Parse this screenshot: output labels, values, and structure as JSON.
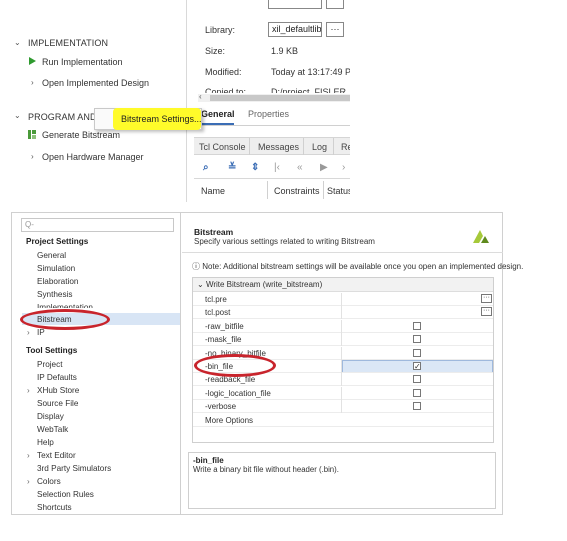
{
  "flow_nav": {
    "implementation_label": "IMPLEMENTATION",
    "run_impl_label": "Run Implementation",
    "open_impl_label": "Open Implemented Design",
    "program_label": "PROGRAM AND D",
    "gen_bitstream_label": "Generate Bitstream",
    "open_hw_label": "Open Hardware Manager"
  },
  "context_menu": {
    "item_label": "Bitstream Settings..."
  },
  "properties": {
    "library_label": "Library:",
    "library_value": "xil_defaultlib",
    "library_btn": "···",
    "size_label": "Size:",
    "size_value": "1.9 KB",
    "modified_label": "Modified:",
    "modified_value": "Today at 13:17:49 PM",
    "copied_label": "Copied to:",
    "copied_value": "D:/project_FISLER_TE",
    "tabs": [
      "General",
      "Properties"
    ]
  },
  "console": {
    "tabs": [
      "Tcl Console",
      "Messages",
      "Log",
      "Re"
    ],
    "columns": [
      "Name",
      "Constraints",
      "Status"
    ]
  },
  "settings_dialog": {
    "search_placeholder": "Q-",
    "project_settings_label": "Project Settings",
    "project_items": [
      "General",
      "Simulation",
      "Elaboration",
      "Synthesis",
      "Implementation",
      "Bitstream",
      "IP"
    ],
    "tool_settings_label": "Tool Settings",
    "tool_items": [
      "Project",
      "IP Defaults",
      "XHub Store",
      "Source File",
      "Display",
      "WebTalk",
      "Help",
      "Text Editor",
      "3rd Party Simulators",
      "Colors",
      "Selection Rules",
      "Shortcuts"
    ],
    "panel_title": "Bitstream",
    "panel_subtitle": "Specify various settings related to writing Bitstream",
    "note": "Note: Additional bitstream settings will be available once you open an implemented design.",
    "group_label": "Write Bitstream (write_bitstream)",
    "options": [
      {
        "name": "tcl.pre",
        "kind": "file",
        "checked": false
      },
      {
        "name": "tcl.post",
        "kind": "file",
        "checked": false
      },
      {
        "name": "-raw_bitfile",
        "kind": "check",
        "checked": false
      },
      {
        "name": "-mask_file",
        "kind": "check",
        "checked": false
      },
      {
        "name": "-no_binary_bitfile",
        "kind": "check",
        "checked": false
      },
      {
        "name": "-bin_file",
        "kind": "check",
        "checked": true
      },
      {
        "name": "-readback_file",
        "kind": "check",
        "checked": false
      },
      {
        "name": "-logic_location_file",
        "kind": "check",
        "checked": false
      },
      {
        "name": "-verbose",
        "kind": "check",
        "checked": false
      },
      {
        "name": "More Options",
        "kind": "text",
        "checked": false
      }
    ],
    "desc_title": "-bin_file",
    "desc_text": "Write a binary bit file without header (.bin).",
    "annotation_color": "#c8242c",
    "highlight_color": "#fffb2a"
  }
}
